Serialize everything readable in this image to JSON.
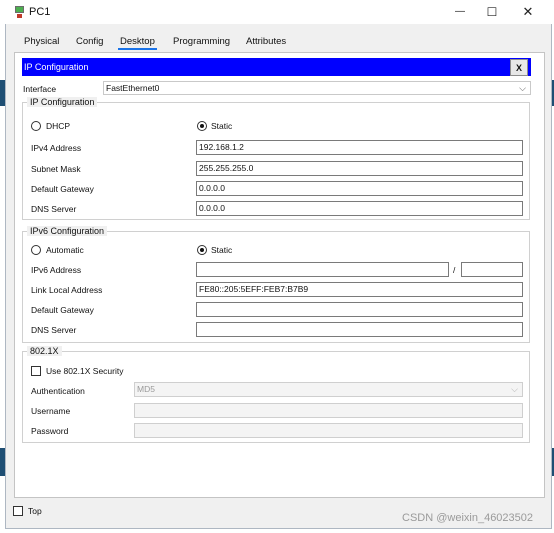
{
  "window": {
    "title": "PC1",
    "minimize_glyph": "—",
    "maximize_glyph": "☐",
    "close_glyph": "✕"
  },
  "tabs": [
    {
      "label": "Physical"
    },
    {
      "label": "Config"
    },
    {
      "label": "Desktop"
    },
    {
      "label": "Programming"
    },
    {
      "label": "Attributes"
    }
  ],
  "active_tab": "Desktop",
  "ip_panel": {
    "header": "IP Configuration",
    "close_label": "X",
    "interface_label": "Interface",
    "interface_value": "FastEthernet0"
  },
  "ipv4": {
    "legend": "IP Configuration",
    "dhcp_label": "DHCP",
    "static_label": "Static",
    "mode": "Static",
    "address_label": "IPv4 Address",
    "address_value": "192.168.1.2",
    "mask_label": "Subnet Mask",
    "mask_value": "255.255.255.0",
    "gateway_label": "Default Gateway",
    "gateway_value": "0.0.0.0",
    "dns_label": "DNS Server",
    "dns_value": "0.0.0.0"
  },
  "ipv6": {
    "legend": "IPv6 Configuration",
    "automatic_label": "Automatic",
    "static_label": "Static",
    "mode": "Static",
    "address_label": "IPv6 Address",
    "address_value": "",
    "prefix_separator": "/",
    "prefix_value": "",
    "link_local_label": "Link Local Address",
    "link_local_value": "FE80::205:5EFF:FEB7:B7B9",
    "gateway_label": "Default Gateway",
    "gateway_value": "",
    "dns_label": "DNS Server",
    "dns_value": ""
  },
  "dot1x": {
    "legend": "802.1X",
    "use_label": "Use 802.1X Security",
    "use_checked": false,
    "auth_label": "Authentication",
    "auth_value": "MD5",
    "username_label": "Username",
    "username_value": "",
    "password_label": "Password",
    "password_value": ""
  },
  "footer": {
    "top_label": "Top",
    "top_checked": false
  },
  "watermark": "CSDN @weixin_46023502",
  "colors": {
    "header_blue": "#0000ff",
    "tab_underline": "#1a73e8",
    "bg_app_blue": "#1e4e73"
  }
}
